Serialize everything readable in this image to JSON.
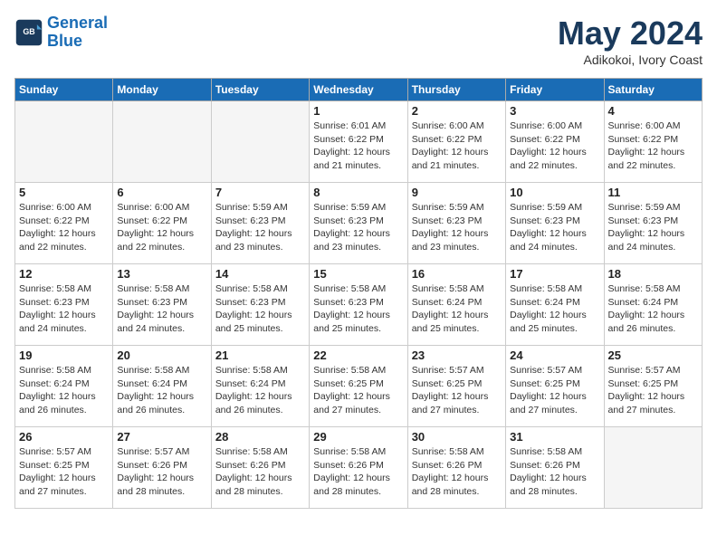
{
  "header": {
    "logo_line1": "General",
    "logo_line2": "Blue",
    "month": "May 2024",
    "location": "Adikokoi, Ivory Coast"
  },
  "days_of_week": [
    "Sunday",
    "Monday",
    "Tuesday",
    "Wednesday",
    "Thursday",
    "Friday",
    "Saturday"
  ],
  "weeks": [
    [
      {
        "day": "",
        "info": ""
      },
      {
        "day": "",
        "info": ""
      },
      {
        "day": "",
        "info": ""
      },
      {
        "day": "1",
        "info": "Sunrise: 6:01 AM\nSunset: 6:22 PM\nDaylight: 12 hours and 21 minutes."
      },
      {
        "day": "2",
        "info": "Sunrise: 6:00 AM\nSunset: 6:22 PM\nDaylight: 12 hours and 21 minutes."
      },
      {
        "day": "3",
        "info": "Sunrise: 6:00 AM\nSunset: 6:22 PM\nDaylight: 12 hours and 22 minutes."
      },
      {
        "day": "4",
        "info": "Sunrise: 6:00 AM\nSunset: 6:22 PM\nDaylight: 12 hours and 22 minutes."
      }
    ],
    [
      {
        "day": "5",
        "info": "Sunrise: 6:00 AM\nSunset: 6:22 PM\nDaylight: 12 hours and 22 minutes."
      },
      {
        "day": "6",
        "info": "Sunrise: 6:00 AM\nSunset: 6:22 PM\nDaylight: 12 hours and 22 minutes."
      },
      {
        "day": "7",
        "info": "Sunrise: 5:59 AM\nSunset: 6:23 PM\nDaylight: 12 hours and 23 minutes."
      },
      {
        "day": "8",
        "info": "Sunrise: 5:59 AM\nSunset: 6:23 PM\nDaylight: 12 hours and 23 minutes."
      },
      {
        "day": "9",
        "info": "Sunrise: 5:59 AM\nSunset: 6:23 PM\nDaylight: 12 hours and 23 minutes."
      },
      {
        "day": "10",
        "info": "Sunrise: 5:59 AM\nSunset: 6:23 PM\nDaylight: 12 hours and 24 minutes."
      },
      {
        "day": "11",
        "info": "Sunrise: 5:59 AM\nSunset: 6:23 PM\nDaylight: 12 hours and 24 minutes."
      }
    ],
    [
      {
        "day": "12",
        "info": "Sunrise: 5:58 AM\nSunset: 6:23 PM\nDaylight: 12 hours and 24 minutes."
      },
      {
        "day": "13",
        "info": "Sunrise: 5:58 AM\nSunset: 6:23 PM\nDaylight: 12 hours and 24 minutes."
      },
      {
        "day": "14",
        "info": "Sunrise: 5:58 AM\nSunset: 6:23 PM\nDaylight: 12 hours and 25 minutes."
      },
      {
        "day": "15",
        "info": "Sunrise: 5:58 AM\nSunset: 6:23 PM\nDaylight: 12 hours and 25 minutes."
      },
      {
        "day": "16",
        "info": "Sunrise: 5:58 AM\nSunset: 6:24 PM\nDaylight: 12 hours and 25 minutes."
      },
      {
        "day": "17",
        "info": "Sunrise: 5:58 AM\nSunset: 6:24 PM\nDaylight: 12 hours and 25 minutes."
      },
      {
        "day": "18",
        "info": "Sunrise: 5:58 AM\nSunset: 6:24 PM\nDaylight: 12 hours and 26 minutes."
      }
    ],
    [
      {
        "day": "19",
        "info": "Sunrise: 5:58 AM\nSunset: 6:24 PM\nDaylight: 12 hours and 26 minutes."
      },
      {
        "day": "20",
        "info": "Sunrise: 5:58 AM\nSunset: 6:24 PM\nDaylight: 12 hours and 26 minutes."
      },
      {
        "day": "21",
        "info": "Sunrise: 5:58 AM\nSunset: 6:24 PM\nDaylight: 12 hours and 26 minutes."
      },
      {
        "day": "22",
        "info": "Sunrise: 5:58 AM\nSunset: 6:25 PM\nDaylight: 12 hours and 27 minutes."
      },
      {
        "day": "23",
        "info": "Sunrise: 5:57 AM\nSunset: 6:25 PM\nDaylight: 12 hours and 27 minutes."
      },
      {
        "day": "24",
        "info": "Sunrise: 5:57 AM\nSunset: 6:25 PM\nDaylight: 12 hours and 27 minutes."
      },
      {
        "day": "25",
        "info": "Sunrise: 5:57 AM\nSunset: 6:25 PM\nDaylight: 12 hours and 27 minutes."
      }
    ],
    [
      {
        "day": "26",
        "info": "Sunrise: 5:57 AM\nSunset: 6:25 PM\nDaylight: 12 hours and 27 minutes."
      },
      {
        "day": "27",
        "info": "Sunrise: 5:57 AM\nSunset: 6:26 PM\nDaylight: 12 hours and 28 minutes."
      },
      {
        "day": "28",
        "info": "Sunrise: 5:58 AM\nSunset: 6:26 PM\nDaylight: 12 hours and 28 minutes."
      },
      {
        "day": "29",
        "info": "Sunrise: 5:58 AM\nSunset: 6:26 PM\nDaylight: 12 hours and 28 minutes."
      },
      {
        "day": "30",
        "info": "Sunrise: 5:58 AM\nSunset: 6:26 PM\nDaylight: 12 hours and 28 minutes."
      },
      {
        "day": "31",
        "info": "Sunrise: 5:58 AM\nSunset: 6:26 PM\nDaylight: 12 hours and 28 minutes."
      },
      {
        "day": "",
        "info": ""
      }
    ]
  ]
}
